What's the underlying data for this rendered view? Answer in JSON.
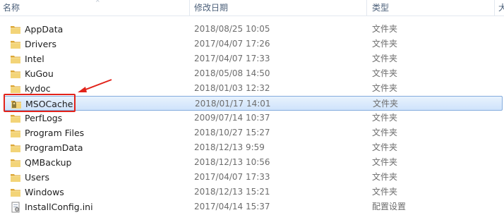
{
  "columns": {
    "name": "名称",
    "date_modified": "修改日期",
    "type": "类型",
    "size": "大"
  },
  "files": [
    {
      "name": "AppData",
      "date": "2018/08/25 10:05",
      "type": "文件夹",
      "icon": "folder-icon"
    },
    {
      "name": "Drivers",
      "date": "2017/04/07 17:26",
      "type": "文件夹",
      "icon": "folder-icon"
    },
    {
      "name": "Intel",
      "date": "2017/04/07 17:33",
      "type": "文件夹",
      "icon": "folder-icon"
    },
    {
      "name": "KuGou",
      "date": "2018/05/08 14:50",
      "type": "文件夹",
      "icon": "folder-icon"
    },
    {
      "name": "kydoc",
      "date": "2018/01/03 12:32",
      "type": "文件夹",
      "icon": "folder-icon"
    },
    {
      "name": "MSOCache",
      "date": "2018/01/17 14:01",
      "type": "文件夹",
      "icon": "locked-folder-icon",
      "selected": true
    },
    {
      "name": "PerfLogs",
      "date": "2009/07/14 10:37",
      "type": "文件夹",
      "icon": "folder-icon"
    },
    {
      "name": "Program Files",
      "date": "2018/10/27 15:27",
      "type": "文件夹",
      "icon": "folder-icon"
    },
    {
      "name": "ProgramData",
      "date": "2018/12/13 9:59",
      "type": "文件夹",
      "icon": "folder-icon"
    },
    {
      "name": "QMBackup",
      "date": "2018/12/13 10:56",
      "type": "文件夹",
      "icon": "folder-icon"
    },
    {
      "name": "Users",
      "date": "2017/04/07 17:33",
      "type": "文件夹",
      "icon": "folder-icon"
    },
    {
      "name": "Windows",
      "date": "2018/12/13 15:21",
      "type": "文件夹",
      "icon": "folder-icon"
    },
    {
      "name": "InstallConfig.ini",
      "date": "2017/04/14 15:37",
      "type": "配置设置",
      "icon": "ini-file-icon"
    }
  ],
  "colors": {
    "highlight_box": "#e2231a",
    "selection_border": "#84acdd",
    "folder": "#e8c25a"
  }
}
